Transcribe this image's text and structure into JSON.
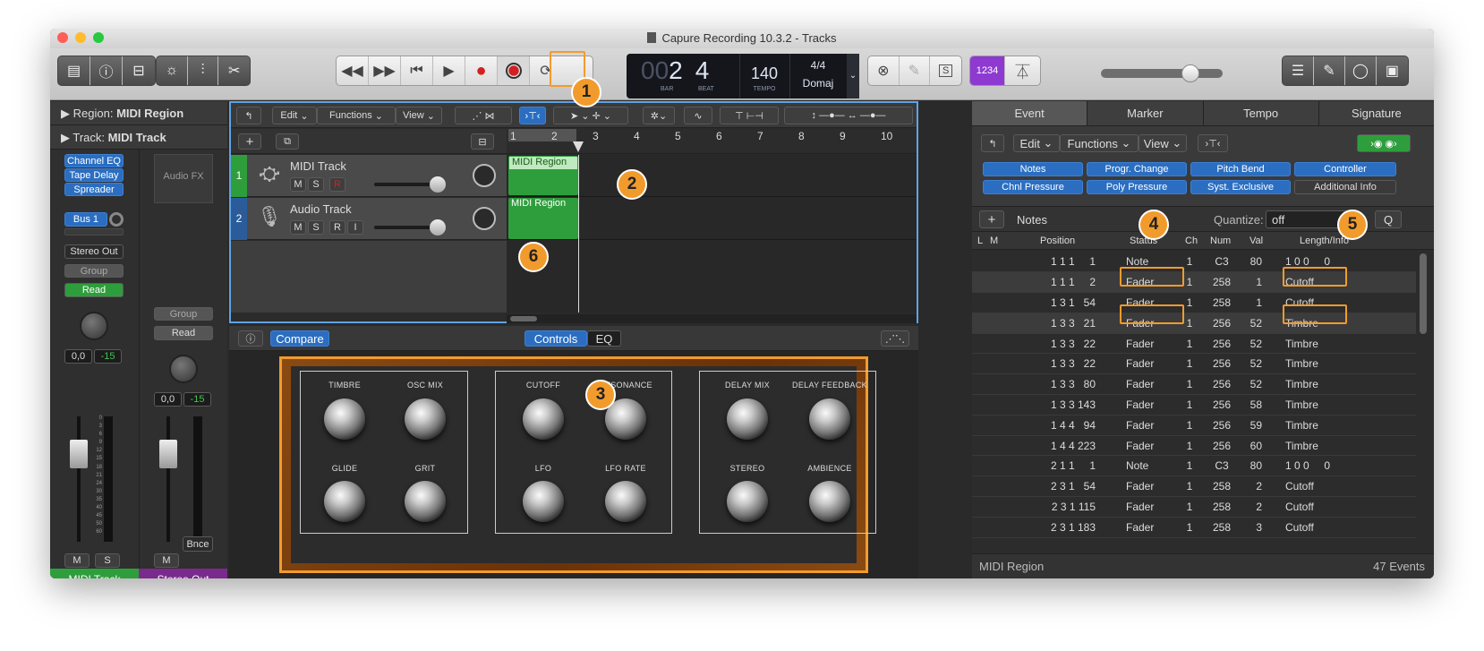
{
  "window": {
    "title": "Capure Recording 10.3.2 - Tracks"
  },
  "lcd": {
    "bar_prefix": "00",
    "bar": "2",
    "beat": "4",
    "bar_label": "BAR",
    "beat_label": "BEAT",
    "tempo": "140",
    "tempo_label": "TEMPO",
    "signature": "4/4",
    "key": "Domaj"
  },
  "count_in": "1234",
  "inspector": {
    "region_label": "Region:",
    "region_value": "MIDI Region",
    "track_label": "Track:",
    "track_value": "MIDI Track",
    "plugins": [
      "Channel EQ",
      "Tape Delay",
      "Spreader"
    ],
    "audio_fx": "Audio FX",
    "send": "Bus 1",
    "output": "Stereo Out",
    "group": "Group",
    "automation": "Read",
    "vol1": "0,0",
    "peak1": "-15",
    "vol2": "0,0",
    "peak2": "-15",
    "bnce": "Bnce",
    "m": "M",
    "s": "S",
    "strip1_name": "MIDI Track",
    "strip2_name": "Stereo Out",
    "scale": [
      "0",
      "3",
      "6",
      "9",
      "12",
      "15",
      "18",
      "21",
      "24",
      "30",
      "35",
      "40",
      "45",
      "50",
      "60"
    ]
  },
  "tracks_area": {
    "menus": [
      "Edit",
      "Functions",
      "View"
    ],
    "ruler": [
      "1",
      "2",
      "3",
      "4",
      "5",
      "6",
      "7",
      "8",
      "9",
      "10"
    ],
    "tracks": [
      {
        "num": "1",
        "name": "MIDI Track",
        "buttons": [
          "M",
          "S",
          "R"
        ],
        "region": "MIDI Region"
      },
      {
        "num": "2",
        "name": "Audio Track",
        "buttons": [
          "M",
          "S",
          "R",
          "I"
        ],
        "region": "MIDI Region"
      }
    ]
  },
  "plugin": {
    "compare": "Compare",
    "controls": "Controls",
    "eq": "EQ",
    "sections": [
      {
        "knobs": [
          "TIMBRE",
          "OSC MIX",
          "GLIDE",
          "GRIT"
        ]
      },
      {
        "knobs": [
          "CUTOFF",
          "RESONANCE",
          "LFO",
          "LFO RATE"
        ]
      },
      {
        "knobs": [
          "DELAY MIX",
          "DELAY FEEDBACK",
          "STEREO",
          "AMBIENCE"
        ]
      }
    ]
  },
  "event_list": {
    "tabs": [
      "Event",
      "Marker",
      "Tempo",
      "Signature"
    ],
    "menus": [
      "Edit",
      "Functions",
      "View"
    ],
    "filters": [
      "Notes",
      "Progr. Change",
      "Pitch Bend",
      "Controller",
      "Chnl Pressure",
      "Poly Pressure",
      "Syst. Exclusive",
      "Additional Info"
    ],
    "create_label": "Notes",
    "quantize_label": "Quantize:",
    "quantize_value": "off",
    "q_button": "Q",
    "columns": [
      "L",
      "M",
      "Position",
      "Status",
      "Ch",
      "Num",
      "Val",
      "Length/Info"
    ],
    "rows": [
      {
        "pos": "1 1 1     1",
        "status": "Note",
        "ch": "1",
        "num": "C3",
        "val": "80",
        "info": "1 0 0     0"
      },
      {
        "pos": "1 1 1     2",
        "status": "Fader",
        "ch": "1",
        "num": "258",
        "val": "1",
        "info": "Cutoff"
      },
      {
        "pos": "1 3 1   54",
        "status": "Fader",
        "ch": "1",
        "num": "258",
        "val": "1",
        "info": "Cutoff"
      },
      {
        "pos": "1 3 3   21",
        "status": "Fader",
        "ch": "1",
        "num": "256",
        "val": "52",
        "info": "Timbre"
      },
      {
        "pos": "1 3 3   22",
        "status": "Fader",
        "ch": "1",
        "num": "256",
        "val": "52",
        "info": "Timbre"
      },
      {
        "pos": "1 3 3   22",
        "status": "Fader",
        "ch": "1",
        "num": "256",
        "val": "52",
        "info": "Timbre"
      },
      {
        "pos": "1 3 3   80",
        "status": "Fader",
        "ch": "1",
        "num": "256",
        "val": "52",
        "info": "Timbre"
      },
      {
        "pos": "1 3 3 143",
        "status": "Fader",
        "ch": "1",
        "num": "256",
        "val": "58",
        "info": "Timbre"
      },
      {
        "pos": "1 4 4   94",
        "status": "Fader",
        "ch": "1",
        "num": "256",
        "val": "59",
        "info": "Timbre"
      },
      {
        "pos": "1 4 4 223",
        "status": "Fader",
        "ch": "1",
        "num": "256",
        "val": "60",
        "info": "Timbre"
      },
      {
        "pos": "2 1 1     1",
        "status": "Note",
        "ch": "1",
        "num": "C3",
        "val": "80",
        "info": "1 0 0     0"
      },
      {
        "pos": "2 3 1   54",
        "status": "Fader",
        "ch": "1",
        "num": "258",
        "val": "2",
        "info": "Cutoff"
      },
      {
        "pos": "2 3 1 115",
        "status": "Fader",
        "ch": "1",
        "num": "258",
        "val": "2",
        "info": "Cutoff"
      },
      {
        "pos": "2 3 1 183",
        "status": "Fader",
        "ch": "1",
        "num": "258",
        "val": "3",
        "info": "Cutoff"
      }
    ],
    "footer_left": "MIDI Region",
    "footer_right": "47 Events"
  },
  "callouts": [
    "1",
    "2",
    "3",
    "4",
    "5",
    "6"
  ],
  "colors": {
    "accent": "#f29b2d",
    "blue": "#2b6ec1",
    "green": "#2e9e3c",
    "purple": "#7a2a8c"
  }
}
